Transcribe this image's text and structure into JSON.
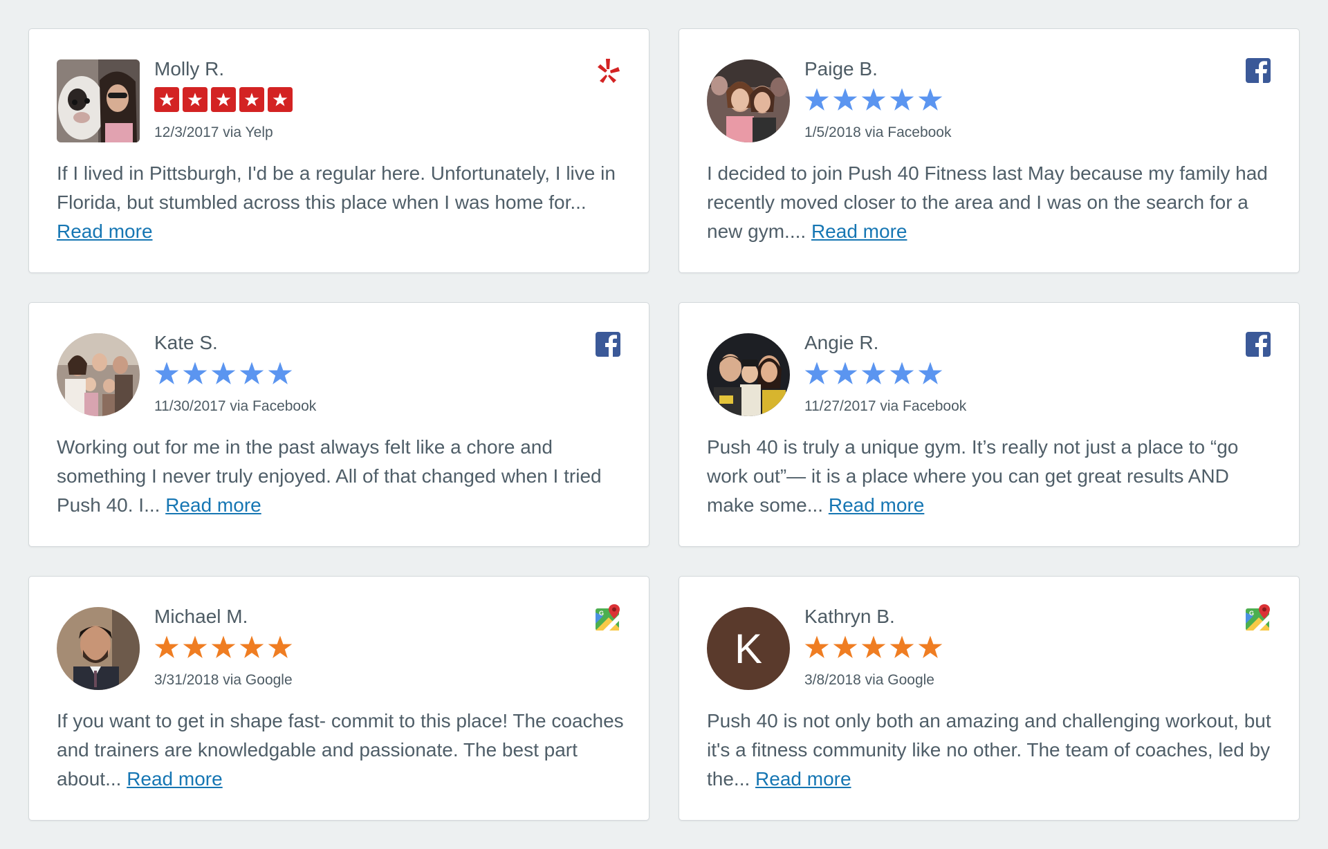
{
  "reviews": [
    {
      "name": "Molly R.",
      "date_source": "12/3/2017 via Yelp",
      "text": "If I lived in Pittsburgh, I'd be a regular here. Unfortunately, I live in Florida, but stumbled across this place when I was home for...",
      "read_more": "Read more",
      "rating": 5,
      "source_icon": "yelp-icon",
      "star_style": "yelp-boxed",
      "star_color": "#d32323"
    },
    {
      "name": "Paige B.",
      "date_source": "1/5/2018 via Facebook",
      "text": "I decided to join Push 40 Fitness last May because my family had recently moved closer to the area and I was on the search for a new gym....",
      "read_more": "Read more",
      "rating": 5,
      "source_icon": "facebook-icon",
      "star_style": "plain",
      "star_color": "#5b95f0"
    },
    {
      "name": "Kate S.",
      "date_source": "11/30/2017 via Facebook",
      "text": "Working out for me in the past always felt like a chore and something I never truly enjoyed. All of that changed when I tried Push 40. I...",
      "read_more": "Read more",
      "rating": 5,
      "source_icon": "facebook-icon",
      "star_style": "plain",
      "star_color": "#5b95f0"
    },
    {
      "name": "Angie R.",
      "date_source": "11/27/2017 via Facebook",
      "text": "Push 40 is truly a unique gym. It’s really not just a place to “go work out”— it is a place where you can get great results AND make some...",
      "read_more": "Read more",
      "rating": 5,
      "source_icon": "facebook-icon",
      "star_style": "plain",
      "star_color": "#5b95f0"
    },
    {
      "name": "Michael M.",
      "date_source": "3/31/2018 via Google",
      "text": "If you want to get in shape fast- commit to this place! The coaches and trainers are knowledgable and passionate. The best part about...",
      "read_more": "Read more",
      "rating": 5,
      "source_icon": "google-maps-icon",
      "star_style": "plain",
      "star_color": "#ef7d22"
    },
    {
      "name": "Kathryn B.",
      "date_source": "3/8/2018 via Google",
      "text": "Push 40 is not only both an amazing and challenging workout, but it's a fitness community like no other. The team of coaches, led by the...",
      "read_more": "Read more",
      "rating": 5,
      "source_icon": "google-maps-icon",
      "star_style": "plain",
      "star_color": "#ef7d22",
      "avatar_letter": "K",
      "avatar_color": "#5a3a2c"
    }
  ],
  "colors": {
    "background": "#edf0f1",
    "link": "#1676b3",
    "facebook": "#3b5998",
    "yelp": "#d32323"
  }
}
